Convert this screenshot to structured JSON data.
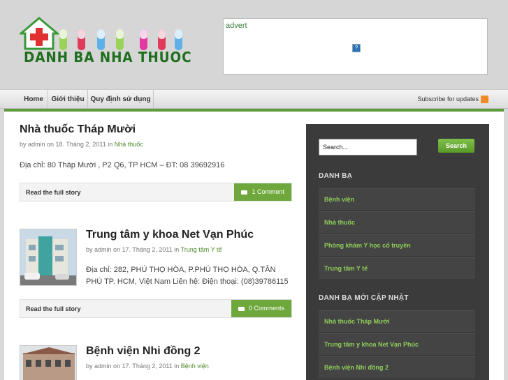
{
  "site": {
    "logo_text": "DANH BA NHA THUOC",
    "advert_label": "advert"
  },
  "nav": {
    "items": [
      "Home",
      "Giới thiệu",
      "Quy định sử dụng"
    ],
    "subscribe_label": "Subscribe for updates"
  },
  "posts": [
    {
      "title": "Nhà thuốc Tháp Mười",
      "meta_prefix": "by admin on 18. Tháng 2, 2011 in",
      "category": "Nhà thuốc",
      "body": "Địa chỉ: 80 Tháp Mười , P2 Q6, TP HCM  – ĐT: 08 39692916",
      "readmore": "Read the full story",
      "comments": "1 Comment"
    },
    {
      "title": "Trung tâm y khoa Net Vạn Phúc",
      "meta_prefix": "by admin on 17. Tháng 2, 2011 in",
      "category": "Trung tâm Y tế",
      "body": "Địa chỉ: 282, PHÚ THỌ HÒA, P.PHÚ THỌ HÒA, Q.TÂN PHÚ TP. HCM,    Việt Nam Liên hệ: Điện thoại: (08)39786115",
      "readmore": "Read the full story",
      "comments": "0 Comments"
    },
    {
      "title": "Bệnh viện Nhi đồng 2",
      "meta_prefix": "by admin on 17. Tháng 2, 2011 in",
      "category": "Bệnh viện"
    }
  ],
  "sidebar": {
    "search_placeholder": "Search...",
    "search_button": "Search",
    "widget1_title": "DANH BẠ",
    "widget1_items": [
      "Bệnh viện",
      "Nhà thuốc",
      "Phòng khám Y học cổ truyền",
      "Trung tâm Y tế"
    ],
    "widget2_title": "DANH BẠ MỚI CẬP NHẬT",
    "widget2_items": [
      "Nhà thuốc Tháp Mười",
      "Trung tâm y khoa Net Vạn Phúc",
      "Bệnh viện Nhi đồng 2"
    ]
  },
  "colors": {
    "accent_green": "#6ea83c",
    "link_green": "#4d8a2a",
    "sidebar_bg": "#3b3b3b"
  }
}
